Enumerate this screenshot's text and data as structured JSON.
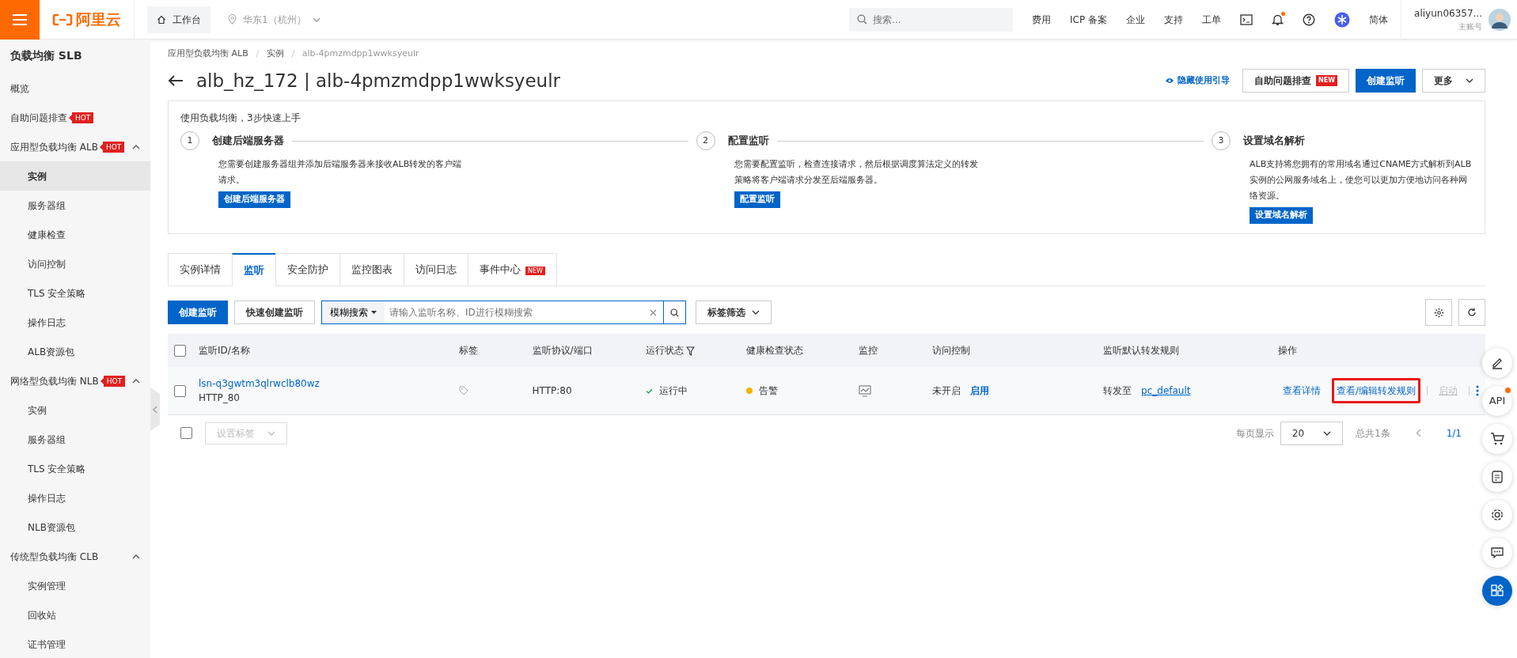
{
  "topbar": {
    "logo": "阿里云",
    "workbench": "工作台",
    "region": "华东1（杭州）",
    "search_placeholder": "搜索...",
    "links": [
      "费用",
      "ICP 备案",
      "企业",
      "支持",
      "工单"
    ],
    "notification_dot": true,
    "language": "简体",
    "user": "aliyun06357...",
    "account_type": "主账号"
  },
  "sidebar": {
    "title": "负载均衡 SLB",
    "items": [
      {
        "kind": "item",
        "label": "概览",
        "selected": false
      },
      {
        "kind": "item",
        "label": "自助问题排查",
        "badge": "HOT",
        "selected": false
      },
      {
        "kind": "group",
        "label": "应用型负载均衡 ALB",
        "badge": "HOT",
        "expanded": true,
        "children": [
          {
            "label": "实例",
            "selected": true
          },
          {
            "label": "服务器组",
            "selected": false
          },
          {
            "label": "健康检查",
            "selected": false
          },
          {
            "label": "访问控制",
            "selected": false
          },
          {
            "label": "TLS 安全策略",
            "selected": false
          },
          {
            "label": "操作日志",
            "selected": false
          },
          {
            "label": "ALB资源包",
            "selected": false
          }
        ]
      },
      {
        "kind": "group",
        "label": "网络型负载均衡 NLB",
        "badge": "HOT",
        "expanded": true,
        "children": [
          {
            "label": "实例",
            "selected": false
          },
          {
            "label": "服务器组",
            "selected": false
          },
          {
            "label": "TLS 安全策略",
            "selected": false
          },
          {
            "label": "操作日志",
            "selected": false
          },
          {
            "label": "NLB资源包",
            "selected": false
          }
        ]
      },
      {
        "kind": "group",
        "label": "传统型负载均衡 CLB",
        "expanded": true,
        "children": [
          {
            "label": "实例管理",
            "selected": false
          },
          {
            "label": "回收站",
            "selected": false
          },
          {
            "label": "证书管理",
            "selected": false
          }
        ]
      }
    ]
  },
  "breadcrumb": [
    "应用型负载均衡 ALB",
    "实例",
    "alb-4pmzmdpp1wwksyeulr"
  ],
  "title": "alb_hz_172 | alb-4pmzmdpp1wwksyeulr",
  "header_actions": [
    {
      "kind": "link",
      "label": "隐藏使用引导"
    },
    {
      "kind": "button",
      "label": "自助问题排查",
      "badge": "NEW"
    },
    {
      "kind": "primary",
      "label": "创建监听"
    },
    {
      "kind": "dropdown",
      "label": "更多"
    }
  ],
  "guide": {
    "intro": "使用负载均衡，3步快速上手",
    "steps": [
      {
        "number": "1",
        "title": "创建后端服务器",
        "text": "您需要创建服务器组并添加后端服务器来接收ALB转发的客户端请求。",
        "button": "创建后端服务器"
      },
      {
        "number": "2",
        "title": "配置监听",
        "text": "您需要配置监听，检查连接请求，然后根据调度算法定义的转发策略将客户端请求分发至后端服务器。",
        "button": "配置监听"
      },
      {
        "number": "3",
        "title": "设置域名解析",
        "text": "ALB支持将您拥有的常用域名通过CNAME方式解析到ALB实例的公网服务域名上，使您可以更加方便地访问各种网络资源。",
        "button": "设置域名解析"
      }
    ]
  },
  "tabs": [
    {
      "label": "实例详情",
      "selected": false
    },
    {
      "label": "监听",
      "selected": true
    },
    {
      "label": "安全防护",
      "selected": false
    },
    {
      "label": "监控图表",
      "selected": false
    },
    {
      "label": "访问日志",
      "selected": false
    },
    {
      "label": "事件中心",
      "selected": false,
      "badge": "NEW"
    }
  ],
  "toolbar": {
    "create": "创建监听",
    "quick_create": "快速创建监听",
    "search_mode": "模糊搜索",
    "search_placeholder": "请输入监听名称、ID进行模糊搜索",
    "tag_filter": "标签筛选"
  },
  "table": {
    "select_all_checked": false,
    "columns": [
      "监听ID/名称",
      "标签",
      "监听协议/端口",
      "运行状态",
      "健康检查状态",
      "监控",
      "访问控制",
      "监听默认转发规则",
      "操作"
    ],
    "rows": [
      {
        "checked": false,
        "id": "lsn-q3gwtm3qlrwclb80wz",
        "name": "HTTP_80",
        "protocol": "HTTP:80",
        "status": "运行中",
        "health": {
          "label": "告警",
          "color": "#f0b400"
        },
        "access": "未开启",
        "access_action": "启用",
        "rule_prefix": "转发至",
        "rule_target": "pc_default",
        "actions": [
          {
            "label": "查看详情",
            "disabled": false,
            "highlighted": false
          },
          {
            "label": "查看/编辑转发规则",
            "disabled": false,
            "highlighted": true
          },
          {
            "label": "启动",
            "disabled": true,
            "highlighted": false
          }
        ]
      }
    ]
  },
  "table_footer": {
    "checked": false,
    "set_tags": "设置标签",
    "per_page_label": "每页显示",
    "per_page": "20",
    "total": "总共1条",
    "page": "1/1"
  },
  "float_buttons": [
    {
      "kind": "edit"
    },
    {
      "kind": "api",
      "label": "API",
      "dot": true
    },
    {
      "kind": "cart"
    },
    {
      "kind": "doc"
    },
    {
      "kind": "settings"
    },
    {
      "kind": "chat"
    },
    {
      "kind": "apps"
    }
  ]
}
